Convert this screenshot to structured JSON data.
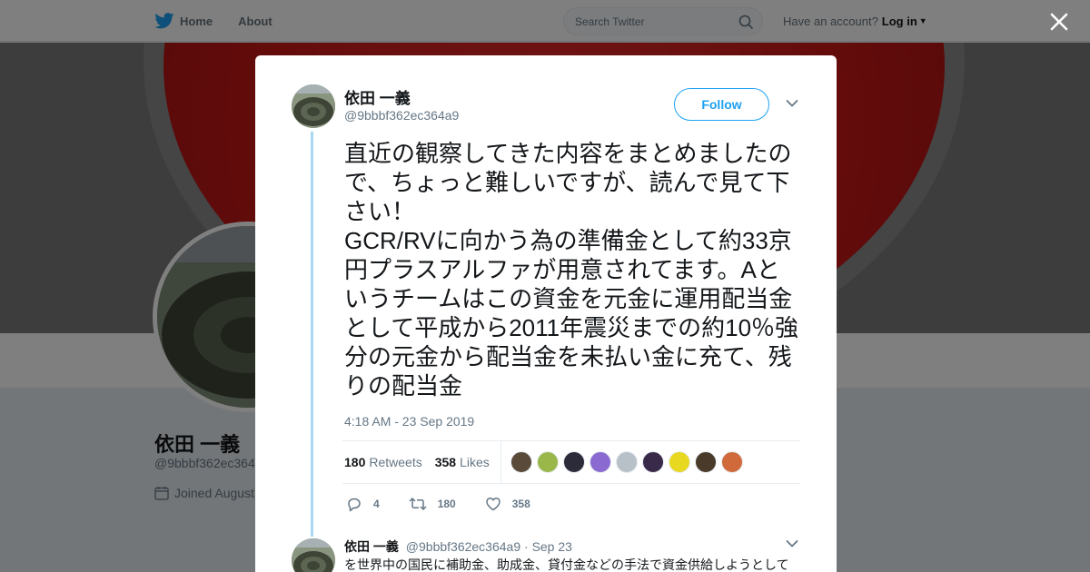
{
  "colors": {
    "brand": "#1da1f2",
    "thread_line": "#a7d9f4",
    "banner_red": "#d21f1f"
  },
  "nav": {
    "home_label": "Home",
    "about_label": "About",
    "search_placeholder": "Search Twitter",
    "have_account": "Have an account?",
    "login_label": "Log in"
  },
  "profile": {
    "name": "依田 一義",
    "handle": "@9bbbf362ec364",
    "joined": "Joined August"
  },
  "tweet": {
    "author_name": "依田 一義",
    "author_handle": "@9bbbf362ec364a9",
    "follow_label": "Follow",
    "text": "直近の観察してきた内容をまとめましたので、ちょっと難しいですが、読んで見て下さい！\nGCR/RVに向かう為の準備金として約33京円プラスアルファが用意されてます。Aというチームはこの資金を元金に運用配当金として平成から2011年震災までの約10％強分の元金から配当金を未払い金に充て、残りの配当金",
    "timestamp": "4:18 AM - 23 Sep 2019",
    "retweets_count": "180",
    "retweets_label": "Retweets",
    "likes_count": "358",
    "likes_label": "Likes",
    "likers": [
      "#5a4a3a",
      "#9ab84a",
      "#2b2b3a",
      "#8a6ad0",
      "#b8c0c8",
      "#3a2a4a",
      "#e8d820",
      "#4a3a2a",
      "#d06a3a"
    ],
    "actions": {
      "replies": "4",
      "retweets": "180",
      "likes": "358"
    }
  },
  "reply": {
    "name": "依田 一義",
    "handle": "@9bbbf362ec364a9",
    "sep": "·",
    "date": "Sep 23",
    "text": "を世界中の国民に補助金、助成金、貸付金などの手法で資金供給しようとして"
  }
}
